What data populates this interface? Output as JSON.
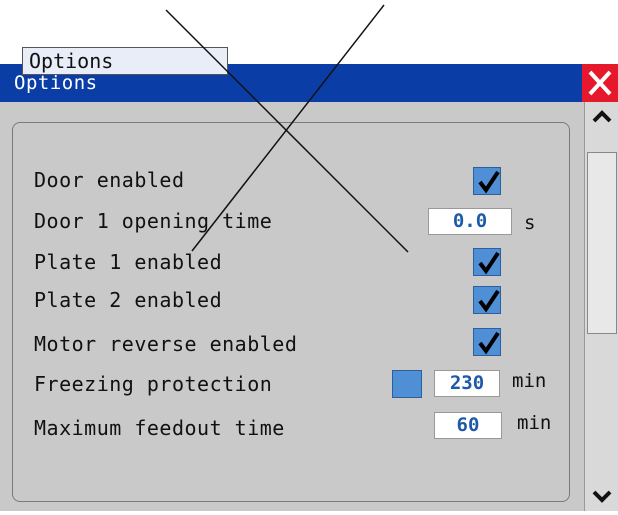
{
  "window": {
    "title": "Options",
    "close_icon": "close-icon",
    "colors": {
      "titlebar": "#0a3ea6",
      "close": "#e6182b",
      "checkbox": "#4f8fd6",
      "value_text": "#1d5aa8"
    }
  },
  "panel": {
    "tab_label": "Options"
  },
  "rows": [
    {
      "label": "Door enabled",
      "control": "checkbox",
      "checked": true
    },
    {
      "label": "Door 1 opening time",
      "control": "value",
      "value": "0.0",
      "unit": "s"
    },
    {
      "label": "Plate 1 enabled",
      "control": "checkbox",
      "checked": true
    },
    {
      "label": "Plate 2 enabled",
      "control": "checkbox",
      "checked": true
    },
    {
      "label": "Motor reverse enabled",
      "control": "checkbox",
      "checked": true
    },
    {
      "label": "Freezing protection",
      "control": "checkbox+value",
      "checked": false,
      "value": "230",
      "unit": "min"
    },
    {
      "label": "Maximum feedout time",
      "control": "value",
      "value": "60",
      "unit": "min"
    }
  ],
  "scrollbar": {
    "up_icon": "chevron-up-icon",
    "down_icon": "chevron-down-icon"
  }
}
